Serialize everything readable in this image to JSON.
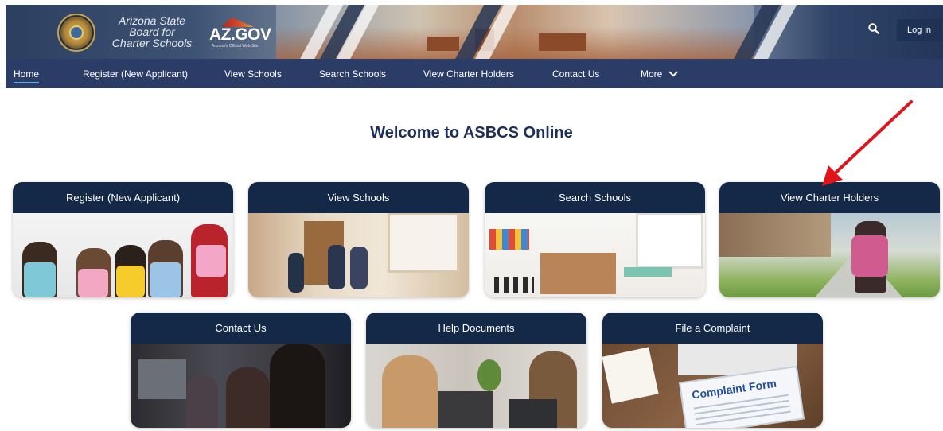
{
  "header": {
    "org_name_line1": "Arizona State",
    "org_name_line2": "Board for",
    "org_name_line3": "Charter Schools",
    "azgov_logo_text": "AZ.GOV",
    "azgov_logo_sub": "Arizona's Official Web Site",
    "login_label": "Log in",
    "search_icon": "search-icon"
  },
  "nav": {
    "items": [
      {
        "label": "Home",
        "active": true
      },
      {
        "label": "Register (New Applicant)"
      },
      {
        "label": "View Schools"
      },
      {
        "label": "Search Schools"
      },
      {
        "label": "View Charter Holders"
      },
      {
        "label": "Contact Us"
      },
      {
        "label": "More"
      }
    ]
  },
  "main": {
    "heading": "Welcome to ASBCS Online",
    "tiles": [
      {
        "label": "Register (New Applicant)"
      },
      {
        "label": "View Schools"
      },
      {
        "label": "Search Schools"
      },
      {
        "label": "View Charter Holders"
      },
      {
        "label": "Contact Us"
      },
      {
        "label": "Help Documents"
      },
      {
        "label": "File a Complaint"
      }
    ],
    "complaint_form_text": "Complaint Form"
  },
  "colors": {
    "nav_bg": "#2b3c66",
    "tile_header_bg": "#142848",
    "heading_color": "#1e2f57",
    "annotation_arrow": "#e0141b"
  }
}
